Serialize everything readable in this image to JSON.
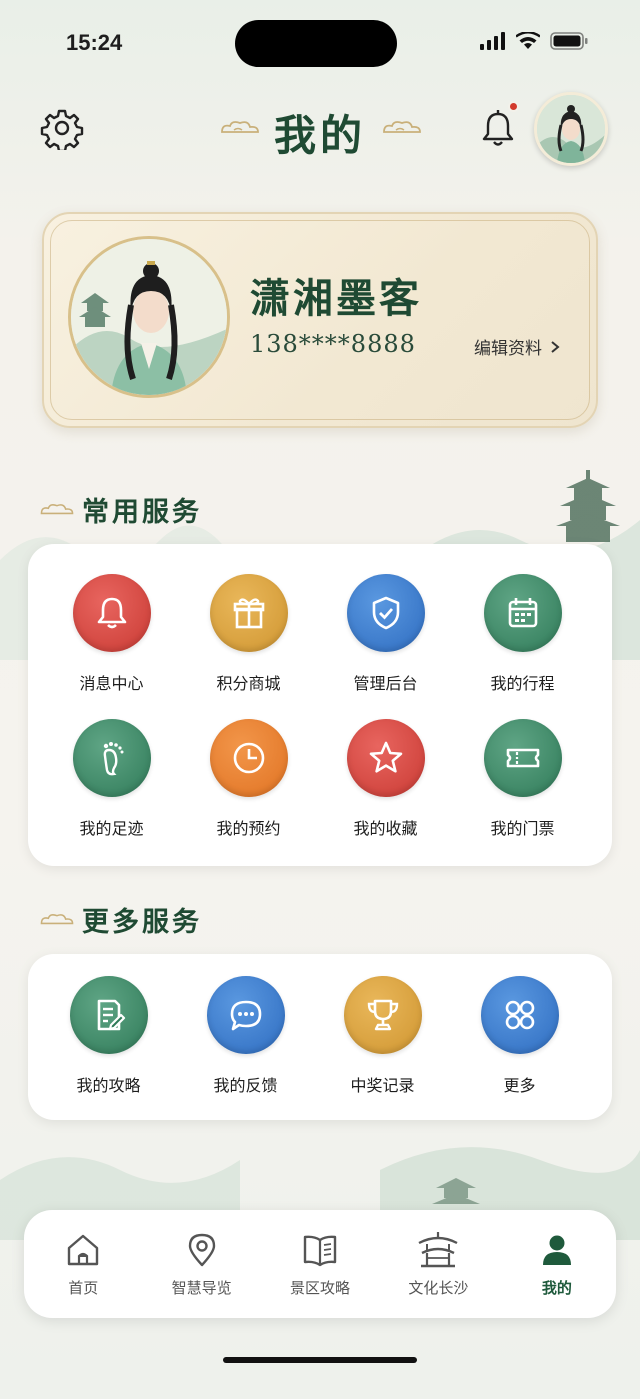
{
  "status_bar": {
    "time": "15:24"
  },
  "header": {
    "title": "我的",
    "notification_badge": true
  },
  "profile": {
    "name": "潇湘墨客",
    "phone": "138****8888",
    "edit_label": "编辑资料"
  },
  "common_services": {
    "title": "常用服务",
    "items": [
      {
        "label": "消息中心",
        "icon": "bell-icon",
        "color": "#d2443d"
      },
      {
        "label": "积分商城",
        "icon": "gift-icon",
        "color": "#d9a143"
      },
      {
        "label": "管理后台",
        "icon": "shield-check-icon",
        "color": "#3b7fd0"
      },
      {
        "label": "我的行程",
        "icon": "calendar-icon",
        "color": "#3a8763"
      },
      {
        "label": "我的足迹",
        "icon": "footprint-icon",
        "color": "#3a8763"
      },
      {
        "label": "我的预约",
        "icon": "clock-icon",
        "color": "#e98232"
      },
      {
        "label": "我的收藏",
        "icon": "star-icon",
        "color": "#d2443d"
      },
      {
        "label": "我的门票",
        "icon": "ticket-icon",
        "color": "#3a8763"
      }
    ]
  },
  "more_services": {
    "title": "更多服务",
    "items": [
      {
        "label": "我的攻略",
        "icon": "note-edit-icon",
        "color": "#3a8763"
      },
      {
        "label": "我的反馈",
        "icon": "chat-bubble-icon",
        "color": "#3b7fd0"
      },
      {
        "label": "中奖记录",
        "icon": "trophy-icon",
        "color": "#d9a143"
      },
      {
        "label": "更多",
        "icon": "grid-icon",
        "color": "#3b7fd0"
      }
    ]
  },
  "tab_bar": {
    "items": [
      {
        "label": "首页",
        "icon": "home-icon",
        "active": false
      },
      {
        "label": "智慧导览",
        "icon": "location-pin-icon",
        "active": false
      },
      {
        "label": "景区攻略",
        "icon": "book-icon",
        "active": false
      },
      {
        "label": "文化长沙",
        "icon": "pavilion-icon",
        "active": false
      },
      {
        "label": "我的",
        "icon": "user-icon",
        "active": true
      }
    ]
  },
  "colors": {
    "primary_green": "#1f4a33",
    "card_bg": "#f5ecd8",
    "badge_red": "#d23a2c"
  }
}
